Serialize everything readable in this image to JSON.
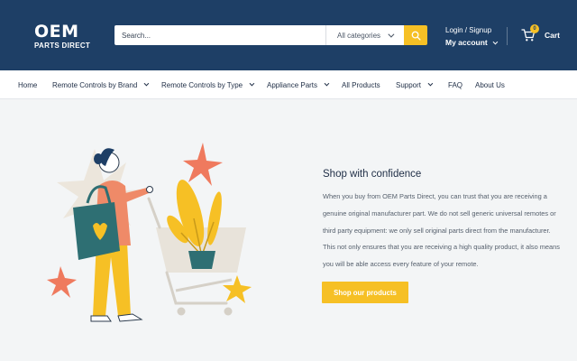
{
  "header": {
    "logo_main": "OEM",
    "logo_sub": "PARTS DIRECT",
    "search_placeholder": "Search...",
    "category_label": "All categories",
    "login_label": "Login / Signup",
    "account_label": "My account",
    "cart_label": "Cart",
    "cart_count": "0"
  },
  "nav": {
    "items": [
      {
        "label": "Home",
        "dropdown": false
      },
      {
        "label": "Remote Controls by Brand",
        "dropdown": true
      },
      {
        "label": "Remote Controls by Type",
        "dropdown": true
      },
      {
        "label": "Appliance Parts",
        "dropdown": true
      },
      {
        "label": "All Products",
        "dropdown": false
      },
      {
        "label": "Support",
        "dropdown": true
      },
      {
        "label": "FAQ",
        "dropdown": false
      },
      {
        "label": "About Us",
        "dropdown": false
      }
    ]
  },
  "hero": {
    "title": "Shop with confidence",
    "body": "When you buy from OEM Parts Direct, you can trust that you are receiving a genuine original manufacturer part. We do not sell generic universal remotes or third party equipment: we only sell original parts direct from the manufacturer. This not only ensures that you are receiving a high quality product, it also means you will be able access every feature of your remote.",
    "cta_label": "Shop our products"
  },
  "colors": {
    "header_bg": "#1e3f66",
    "accent": "#f6c025",
    "coral": "#ef7a5e",
    "teal": "#2e6f73"
  }
}
